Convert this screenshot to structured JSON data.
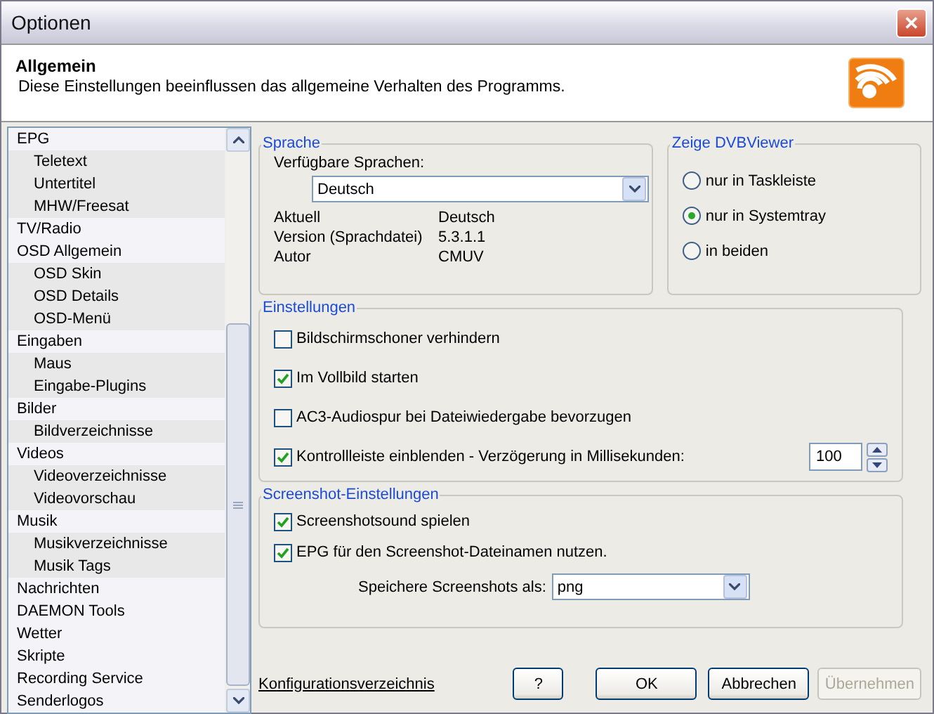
{
  "window": {
    "title": "Optionen",
    "close": "✕"
  },
  "header": {
    "title": "Allgemein",
    "description": "Diese Einstellungen beeinflussen das allgemeine Verhalten des Programms."
  },
  "tree": {
    "items": [
      {
        "label": "EPG",
        "children": [
          {
            "label": "Teletext"
          },
          {
            "label": "Untertitel"
          },
          {
            "label": "MHW/Freesat"
          }
        ]
      },
      {
        "label": "TV/Radio"
      },
      {
        "label": "OSD Allgemein",
        "children": [
          {
            "label": "OSD Skin"
          },
          {
            "label": "OSD Details"
          },
          {
            "label": "OSD-Menü"
          }
        ]
      },
      {
        "label": "Eingaben",
        "children": [
          {
            "label": "Maus"
          },
          {
            "label": "Eingabe-Plugins"
          }
        ]
      },
      {
        "label": "Bilder",
        "children": [
          {
            "label": "Bildverzeichnisse"
          }
        ]
      },
      {
        "label": "Videos",
        "children": [
          {
            "label": "Videoverzeichnisse"
          },
          {
            "label": "Videovorschau"
          }
        ]
      },
      {
        "label": "Musik",
        "children": [
          {
            "label": "Musikverzeichnisse"
          },
          {
            "label": "Musik Tags"
          }
        ]
      },
      {
        "label": "Nachrichten"
      },
      {
        "label": "DAEMON Tools"
      },
      {
        "label": "Wetter"
      },
      {
        "label": "Skripte"
      },
      {
        "label": "Recording Service"
      },
      {
        "label": "Senderlogos"
      }
    ]
  },
  "language": {
    "title": "Sprache",
    "label": "Verfügbare Sprachen:",
    "dropdown": {
      "value": "Deutsch"
    },
    "info": [
      {
        "label": "Aktuell",
        "value": "Deutsch"
      },
      {
        "label": "Version (Sprachdatei)",
        "value": "5.3.1.1"
      },
      {
        "label": "Autor",
        "value": "CMUV"
      }
    ]
  },
  "show": {
    "title": "Zeige DVBViewer",
    "options": [
      {
        "label": "nur in Taskleiste",
        "selected": false
      },
      {
        "label": "nur in Systemtray",
        "selected": true
      },
      {
        "label": "in beiden",
        "selected": false
      }
    ]
  },
  "settings": {
    "title": "Einstellungen",
    "options": [
      {
        "label": "Bildschirmschoner verhindern",
        "checked": false
      },
      {
        "label": "Im Vollbild starten",
        "checked": true
      },
      {
        "label": "AC3-Audiospur bei Dateiwiedergabe bevorzugen",
        "checked": false
      },
      {
        "label": "Kontrollleiste einblenden - Verzögerung in Millisekunden:",
        "checked": true,
        "spinner": {
          "value": "100"
        }
      }
    ]
  },
  "screenshot": {
    "title": "Screenshot-Einstellungen",
    "options": [
      {
        "label": "Screenshotsound spielen",
        "checked": true
      },
      {
        "label": "EPG für den Screenshot-Dateinamen nutzen.",
        "checked": true
      }
    ],
    "format": {
      "label": "Speichere Screenshots als:",
      "value": "png"
    }
  },
  "footer": {
    "link": "Konfigurationsverzeichnis",
    "buttons": [
      {
        "label": "?",
        "disabled": false
      },
      {
        "label": "OK",
        "disabled": false
      },
      {
        "label": "Abbrechen",
        "disabled": false
      },
      {
        "label": "Übernehmen",
        "disabled": true
      }
    ]
  }
}
